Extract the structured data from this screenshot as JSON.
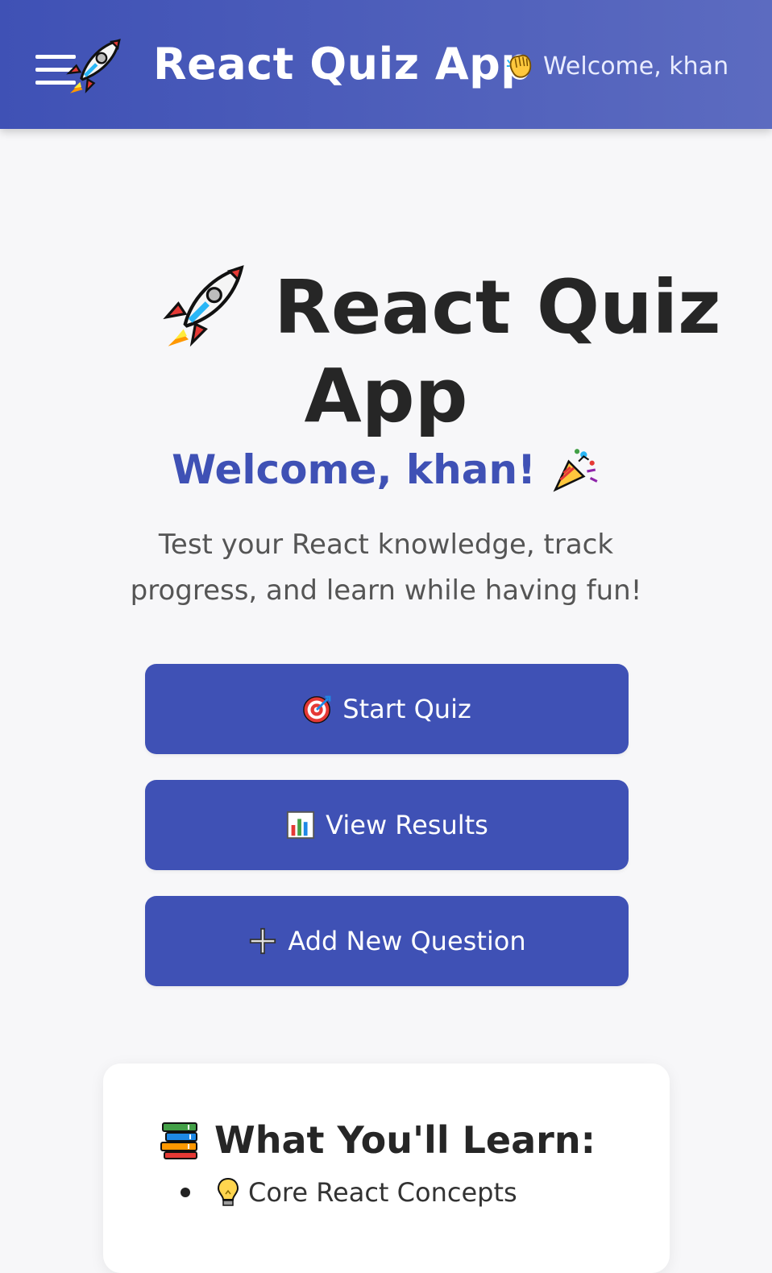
{
  "navbar": {
    "title": "React Quiz App",
    "welcome": "Welcome, khan",
    "menu_icon": "hamburger-menu-icon",
    "logo_icon": "rocket-icon",
    "welcome_icon": "waving-hand-icon",
    "background_colors": [
      "#3f51b5",
      "#5c6bc0"
    ]
  },
  "hero": {
    "title_line1": "React Quiz",
    "title_line2": "App",
    "title_icon": "rocket-icon",
    "welcome": "Welcome, khan!",
    "welcome_icon": "party-popper-icon",
    "welcome_color": "#3f51b5",
    "description": "Test your React knowledge, track progress, and learn while having fun!"
  },
  "actions": {
    "button_color": "#3f51b5",
    "start": {
      "label": "Start Quiz",
      "icon": "target-icon"
    },
    "results": {
      "label": "View Results",
      "icon": "bar-chart-icon"
    },
    "add": {
      "label": "Add New Question",
      "icon": "plus-icon"
    }
  },
  "learn": {
    "heading": "What You'll Learn:",
    "heading_icon": "books-icon",
    "items": [
      {
        "label": "Core React Concepts",
        "icon": "lightbulb-icon"
      }
    ]
  }
}
